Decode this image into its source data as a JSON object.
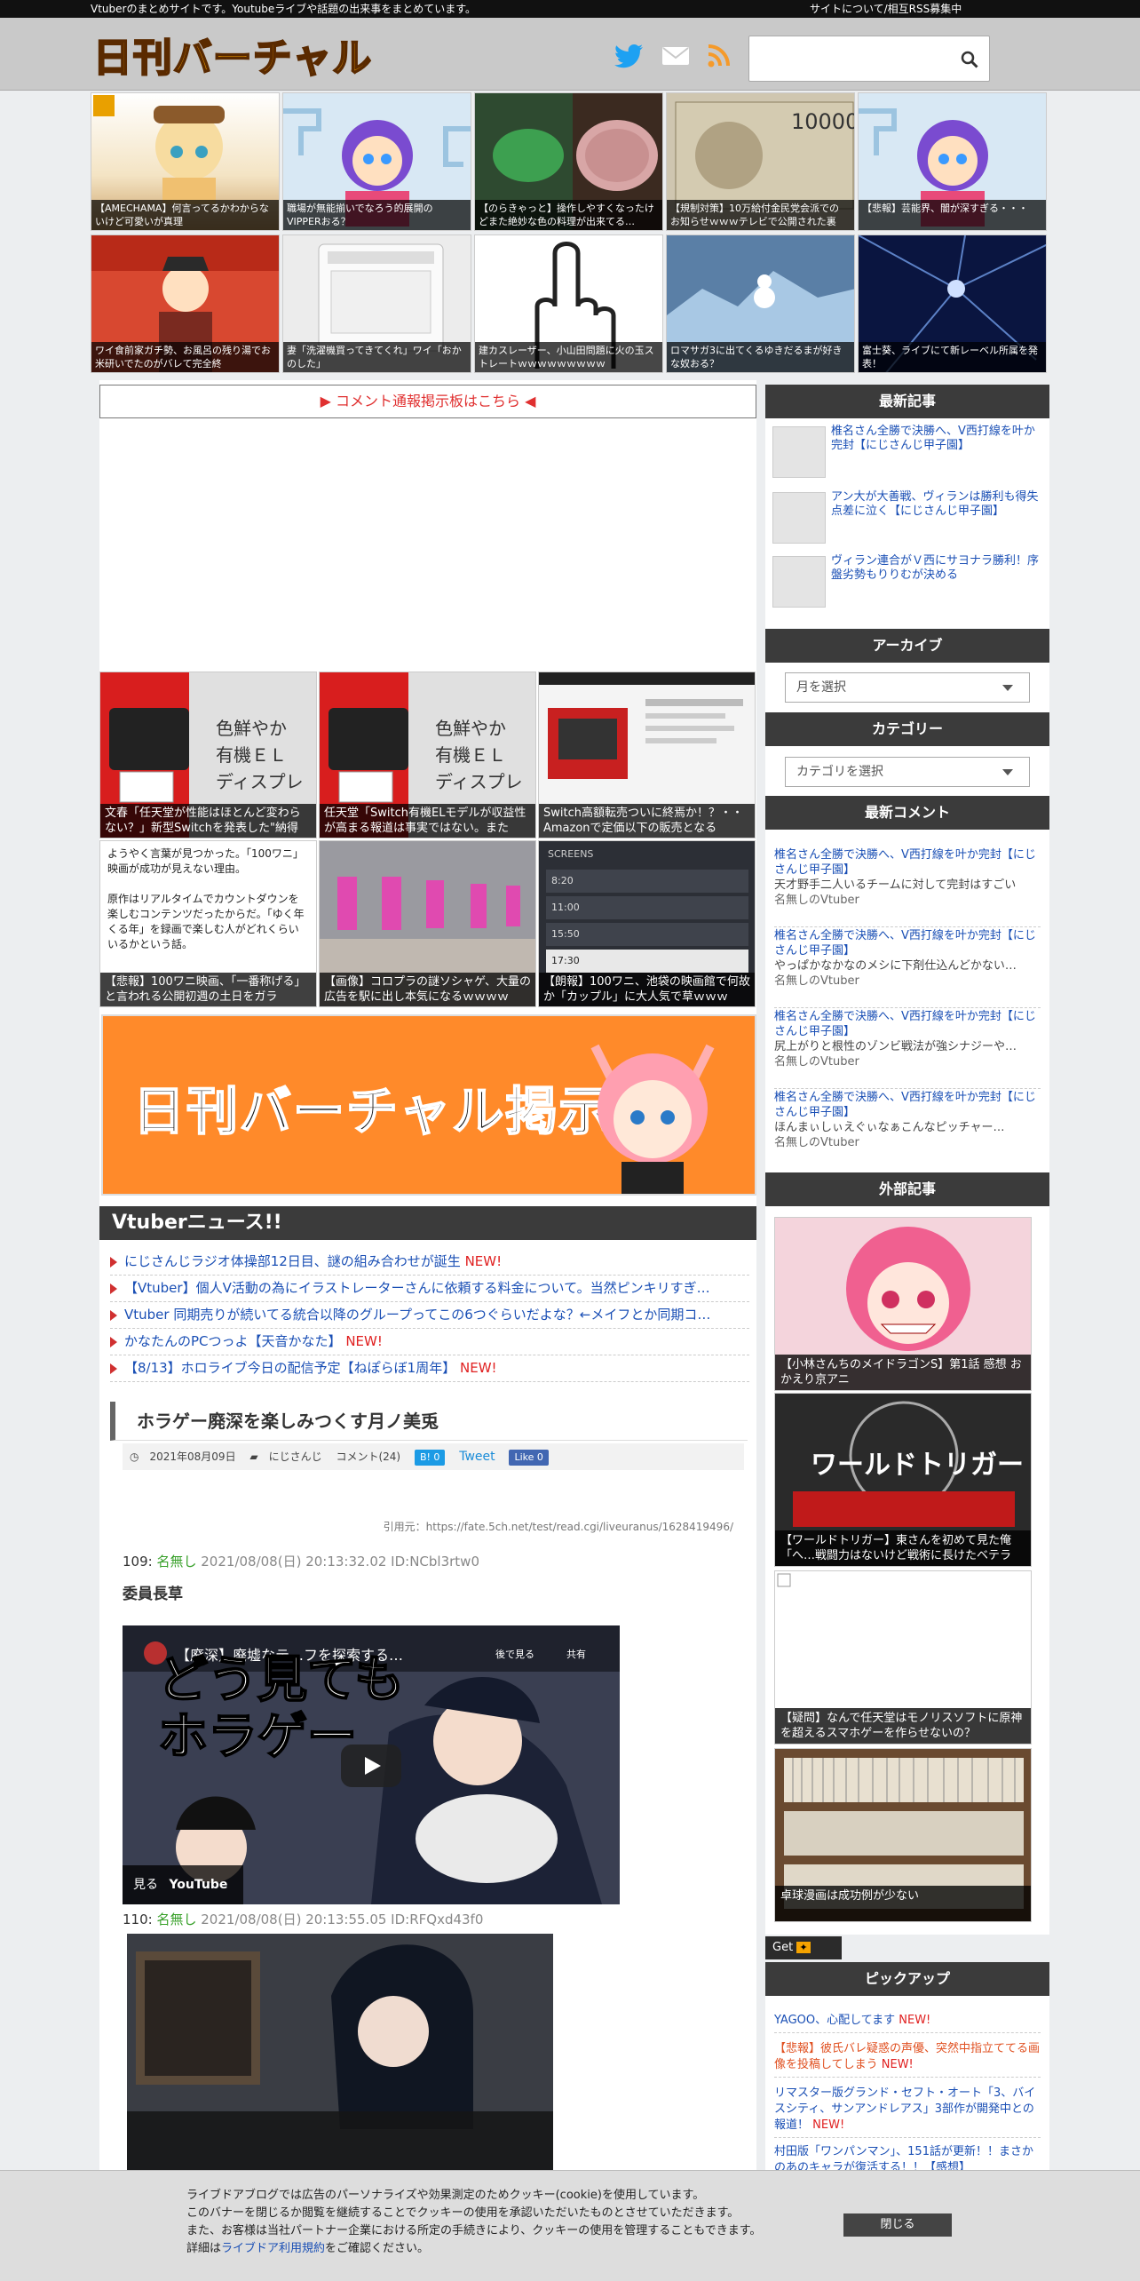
{
  "topbar": {
    "tagline": "Vtuberのまとめサイトです。Youtubeライブや話題の出来事をまとめています。",
    "links": "サイトについて/相互RSS募集中"
  },
  "header": {
    "logo": "日刊バーチャル"
  },
  "tiles": [
    {
      "caption": "【AMECHAMA】何言ってるかわからないけど可愛いが真理"
    },
    {
      "caption": "職場が無能揃いでなろう的展開のVIPPERおる？"
    },
    {
      "caption": "【のらきゃっと】操作しやすくなったけどまた絶妙な色の料理が出来てる…"
    },
    {
      "caption": "【規制対策】10万給付金民党会派での お知らせｗｗｗテレビで公開された裏"
    },
    {
      "caption": "【悲報】芸能界、闇が深すぎる・・・"
    },
    {
      "caption": "ワイ食前家ガチ勢、お風呂の残り湯でお米研いでたのがバレて完全終"
    },
    {
      "caption": "妻「洗濯機買ってきてくれ」ワイ「おかのした」"
    },
    {
      "caption": "建カスレーザー、小山田問題に火の玉ストレートｗｗｗｗｗｗｗｗｗ"
    },
    {
      "caption": "ロマサガ3に出てくるゆきだるまが好きな奴おる？"
    },
    {
      "caption": "富士葵、ライブにて新レーベル所属を発表！"
    }
  ],
  "main": {
    "notice": "▶ コメント通報掲示板はこちら ◀",
    "thumbs": [
      {
        "caption": "文春「任天堂が性能はほとんど変わらない？」新型Switchを発表した\"納得"
      },
      {
        "caption": "任天堂「Switch有機ELモデルが収益性が高まる報道は事実ではない。また"
      },
      {
        "caption": "Switch高額転売ついに終焉か！？・・Amazonで定価以下の販売となる"
      },
      {
        "caption": "【悲報】100ワニ映画、「一番称げる」と言われる公開初週の土日をガラ"
      },
      {
        "caption": "【画像】コロプラの謎ソシャゲ、大量の広告を駅に出し本気になるｗｗｗｗ"
      },
      {
        "caption": "【朗報】100ワニ、池袋の映画館で何故か「カップル」に大人気で草ｗｗｗ"
      }
    ],
    "thumb4_text": "ようやく言葉が見つかった。「100ワニ」映画が成功が見えない理由。\n\n原作はリアルタイムでカウントダウンを楽しむコンテンツだったからだ。「ゆく年くる年」を録画で楽しむ人がどれくらいいるかという話。",
    "screens": {
      "title": "SCREENS",
      "rows": [
        "8:20",
        "11:00",
        "15:50",
        "17:30"
      ]
    },
    "banner": "日刊バーチャル掲示板",
    "vnews_title": "Vtuberニュース!!",
    "news": [
      {
        "text": "にじさんじラジオ体操部12日目、謎の組み合わせが誕生",
        "new": "NEW!"
      },
      {
        "text": "【Vtuber】個人V活動の為にイラストレーターさんに依頼する料金について。当然ピンキリすぎ…",
        "new": ""
      },
      {
        "text": "Vtuber 同期売りが続いてる統合以降のグループってこの6つぐらいだよな？←メイフとか同期コ…",
        "new": ""
      },
      {
        "text": "かなたんのPCつっよ【天音かなた】",
        "new": "NEW!"
      },
      {
        "text": "【8/13】ホロライブ今日の配信予定【ねぽらぼ1周年】",
        "new": "NEW!"
      }
    ],
    "article": {
      "title": "ホラゲー廃深を楽しみつくす月ノ美兎",
      "date": "2021年08月09日",
      "category": "にじさんじ",
      "comments": "コメント(24)",
      "hatena": "B! 0",
      "tweet": "Tweet",
      "like": "Like 0",
      "source": "引用元：https://fate.5ch.net/test/read.cgi/liveuranus/1628419496/",
      "posts": [
        {
          "num": "109:",
          "name": "名無し",
          "date": "2021/08/08(日) 20:13:32.02 ID:NCbl3rtw0"
        },
        {
          "num": "110:",
          "name": "名無し",
          "date": "2021/08/08(日) 20:13:55.05 ID:RFQxd43f0"
        }
      ],
      "body1": "委員長草",
      "video": {
        "title": "【廃深】廃墟なテ…フを探索する…",
        "later": "後で見る",
        "share": "共有",
        "watch": "見る",
        "yt": "YouTube",
        "overlay": "どう見ても ホラゲー"
      }
    }
  },
  "sidebar": {
    "recent_title": "最新記事",
    "recent": [
      {
        "text": "椎名さん全勝で決勝へ、V西打線を叶か完封【にじさんじ甲子園】"
      },
      {
        "text": "アン大が大善戦、ヴィランは勝利も得失点差に泣く【にじさんじ甲子園】"
      },
      {
        "text": "ヴィラン連合がＶ西にサヨナラ勝利！序盤劣勢もりりむが決める"
      }
    ],
    "archive_title": "アーカイブ",
    "archive_select": "月を選択",
    "category_title": "カテゴリー",
    "category_select": "カテゴリを選択",
    "comments_title": "最新コメント",
    "comments": [
      {
        "a": "椎名さん全勝で決勝へ、V西打線を叶か完封【にじさんじ甲子園】",
        "b": "天才野手二人いるチームに対して完封はすごい",
        "c": "名無しのVtuber"
      },
      {
        "a": "椎名さん全勝で決勝へ、V西打線を叶か完封【にじさんじ甲子園】",
        "b": "やっぱかなかなのメシに下剤仕込んどかない…",
        "c": "名無しのVtuber"
      },
      {
        "a": "椎名さん全勝で決勝へ、V西打線を叶か完封【にじさんじ甲子園】",
        "b": "尻上がりと根性のゾンビ戦法が強シナジーや…",
        "c": "名無しのVtuber"
      },
      {
        "a": "椎名さん全勝で決勝へ、V西打線を叶か完封【にじさんじ甲子園】",
        "b": "ほんまぃしぃえぐぃなぁこんなピッチャー…",
        "c": "名無しのVtuber"
      }
    ],
    "external_title": "外部記事",
    "external": [
      {
        "caption": "【小林さんちのメイドラゴンS】第1話 感想 おかえり京アニ"
      },
      {
        "caption": "【ワールドトリガー】東さんを初めて見た俺「へ…戦闘力はないけど戦術に長けたベテラ"
      },
      {
        "caption": "【疑問】なんで任天堂はモノリスソフトに原神を超えるスマホゲーを作らせないの？"
      },
      {
        "caption": "卓球漫画は成功例が少ない"
      }
    ],
    "get_label": "Get",
    "pickup_title": "ピックアップ",
    "pickup": [
      {
        "text": "YAGOO、心配してます",
        "new": "NEW!",
        "red": false
      },
      {
        "text": "【悲報】彼氏バレ疑惑の声優、突然中指立ててる画像を投稿してしまう",
        "new": "NEW!",
        "red": true
      },
      {
        "text": "リマスター版グランド・セフト・オート「3、バイスシティ、サンアンドレアス」3部作が開発中との報道！",
        "new": "NEW!",
        "red": false
      },
      {
        "text": "村田版「ワンパンマン」、151話が更新！！まさかのあのキャラが復活する！！【感想】",
        "new": "",
        "red": false
      }
    ]
  },
  "cookie": {
    "line1": "ライブドアブログでは広告のパーソナライズや効果測定のためクッキー(cookie)を使用しています。",
    "line2": "このバナーを閉じるか閲覧を継続することでクッキーの使用を承認いただいたものとさせていただきます。",
    "line3": "また、お客様は当社パートナー企業における所定の手続きにより、クッキーの使用を管理することもできます。",
    "line4_pre": "詳細は",
    "line4_link": "ライブドア利用規約",
    "line4_post": "をご確認ください。",
    "close": "閉じる"
  },
  "colors": {
    "accent_red": "#e02020",
    "link_blue": "#1a4fb5",
    "header_dark": "#3b3b3b",
    "twitter": "#1da1f2",
    "rss": "#f59a2a"
  }
}
